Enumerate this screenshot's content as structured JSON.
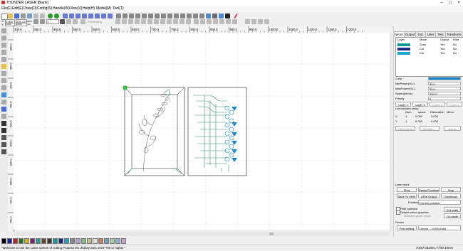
{
  "window": {
    "title": "THUNDER LASER [Blank]"
  },
  "menu": [
    "File(F)",
    "Edit(E)",
    "Draw(D)",
    "Config(S)",
    "Handle(W)",
    "View(V)",
    "Help(H)",
    "Model(M)",
    "Tool(T)"
  ],
  "toolbar": {
    "pos_label1": "X",
    "pos_value1": "0.000",
    "pos_label2": "Y",
    "pos_value2": "0.000",
    "size_value1": "235.417",
    "size_value2": "0.000",
    "unit1": "mm",
    "unit2": "mm",
    "process_no": "1",
    "processing_label": "Processing"
  },
  "ruler": {
    "top_ticks": [
      "300.0",
      "400.0",
      "450.0",
      "500.0",
      "550.0",
      "600.0",
      "650.0",
      "700.0",
      "750.0",
      "800.0",
      "850.0",
      "900.0",
      "950.0",
      "1000.0",
      "1050.0",
      "1100.0",
      "1150.0",
      "1200.0"
    ],
    "left_ticks": [
      "300.0",
      "350.0",
      "400.0",
      "450.0",
      "500.0",
      "550.0",
      "600.0",
      "650.0",
      "700.0",
      "750.0"
    ]
  },
  "panel": {
    "tabs": [
      "Work",
      "Output",
      "Doc",
      "User",
      "Test",
      "Transform"
    ],
    "layer_headers": [
      "Layer",
      "Mode",
      "Output",
      "Hide"
    ],
    "layers": [
      {
        "color": "#0a9a9a",
        "mode": "Scan",
        "output": "Yes",
        "hide": "No"
      },
      {
        "color": "#1a2a8a",
        "mode": "Cut",
        "output": "Yes",
        "hide": "No"
      },
      {
        "color": "#15a8c8",
        "mode": "Cut",
        "output": "Yes",
        "hide": "No"
      }
    ],
    "props": [
      {
        "label": "Color",
        "value": ""
      },
      {
        "label": "MinPower(%)-1",
        "value": "30.0"
      },
      {
        "label": "MaxPower(%)-1",
        "value": "30.0"
      },
      {
        "label": "Speed(mm/s)",
        "value": "100.0"
      },
      {
        "label": "Priority",
        "value": "0"
      }
    ],
    "layer_buttons": [
      "Layer 1",
      "Layer 2",
      "Layer 3",
      "Layer 4"
    ],
    "array_title": "Line/column setup",
    "array_headers": [
      "Num",
      "space",
      "Dislocation",
      "Mirror"
    ],
    "array_rows": [
      {
        "axis": "X",
        "num": "1",
        "space": "0.000",
        "disl": "0.000"
      },
      {
        "axis": "Y",
        "num": "1",
        "space": "0.000",
        "disl": "0.000"
      }
    ],
    "array_buttons": [
      "Virtual array",
      "Breaklin...",
      "Adjust"
    ],
    "laser_work_title": "Laser work",
    "work_buttons": [
      "Start",
      "Pause/Continue",
      "Stop",
      "Save To UFile",
      "UFile Output",
      "Download"
    ],
    "position_label": "Position",
    "position_value": "Current position",
    "path_optimize": "Path optimize",
    "output_select": "Output select graphics",
    "selected_orig": "Selected graph origin",
    "cut_scale": "Cut scale",
    "go_scale": "Go scale",
    "device_title": "Device",
    "port_setting": "Port setting",
    "device_value": "Device -- (USB:Auto)"
  },
  "palette": [
    "#000000",
    "#1520a6",
    "#c81e1e",
    "#1e7a1e",
    "#d4b800",
    "#7a1e7a",
    "#1e9a9a",
    "#6a4a2a",
    "#3a3a3a",
    "#0a9a9a",
    "#1a2a8a",
    "#15a8c8",
    "#888888",
    "#b0a0d0",
    "#80c080",
    "#c0c080",
    "#e0e0e0",
    "#d08050",
    "#70a0c0",
    "#a0d0a0",
    "#90b0e0",
    "#d0a0d0"
  ],
  "status": {
    "message": "*Welcome to use the Laser system of cutting,Propose the display area 1024*768 or higher *",
    "coords": "X:657.063mm,Y:750.19mm"
  },
  "colors": {
    "selection": "#2ecc40",
    "accent": "#1a8ad4",
    "design": "#3a8f7a"
  }
}
